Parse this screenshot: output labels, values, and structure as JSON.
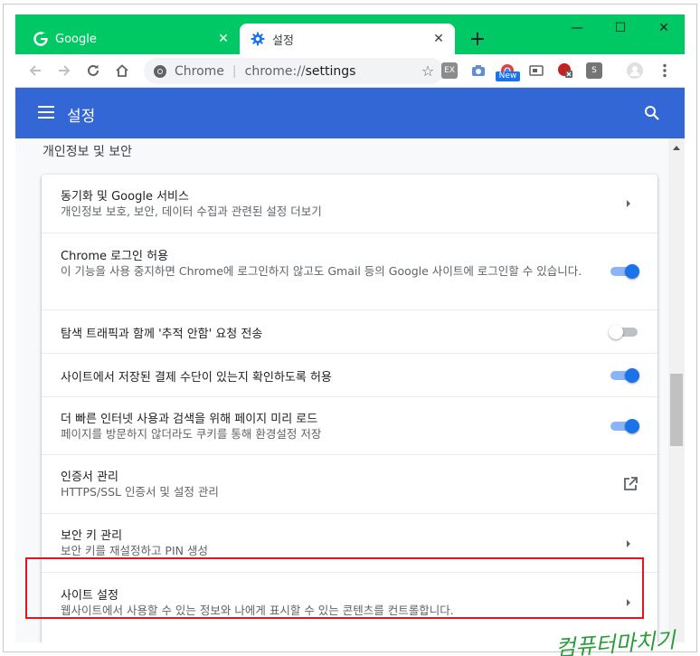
{
  "colors": {
    "frame": "#00c864",
    "header": "#3367d6",
    "toggle_on": "#1a73e8",
    "highlight": "#e8141b"
  },
  "tabs": [
    {
      "title": "Google",
      "icon": "google-g-icon",
      "close": "✕"
    },
    {
      "title": "설정",
      "icon": "settings-gear-icon",
      "close": "✕"
    }
  ],
  "new_tab": "+",
  "window_controls": {
    "minimize": "—",
    "maximize": "☐",
    "close": "✕"
  },
  "omnibox": {
    "chip": "Chrome",
    "separator": "|",
    "url_scheme": "chrome://",
    "url_path": "settings"
  },
  "extensions": {
    "new_badge": "New"
  },
  "header": {
    "title": "설정"
  },
  "section": {
    "heading": "개인정보 및 보안"
  },
  "rows": [
    {
      "title": "동기화 및 Google 서비스",
      "subtitle": "개인정보 보호, 보안, 데이터 수집과 관련된 설정 더보기",
      "control": "arrow"
    },
    {
      "title": "Chrome 로그인 허용",
      "subtitle": "이 기능을 사용 중지하면 Chrome에 로그인하지 않고도 Gmail 등의 Google 사이트에 로그인할 수 있습니다.",
      "control": "toggle",
      "state": true
    },
    {
      "title": "탐색 트래픽과 함께 '추적 안함' 요청 전송",
      "subtitle": "",
      "control": "toggle",
      "state": false
    },
    {
      "title": "사이트에서 저장된 결제 수단이 있는지 확인하도록 허용",
      "subtitle": "",
      "control": "toggle",
      "state": true
    },
    {
      "title": "더 빠른 인터넷 사용과 검색을 위해 페이지 미리 로드",
      "subtitle": "페이지를 방문하지 않더라도 쿠키를 통해 환경설정 저장",
      "control": "toggle",
      "state": true
    },
    {
      "title": "인증서 관리",
      "subtitle": "HTTPS/SSL 인증서 및 설정 관리",
      "control": "external"
    },
    {
      "title": "보안 키 관리",
      "subtitle": "보안 키를 재설정하고 PIN 생성",
      "control": "arrow"
    },
    {
      "title": "사이트 설정",
      "subtitle": "웹사이트에서 사용할 수 있는 정보와 나에게 표시할 수 있는 콘텐츠를 컨트롤합니다.",
      "control": "arrow"
    }
  ],
  "watermark": "컴퓨터마치기"
}
